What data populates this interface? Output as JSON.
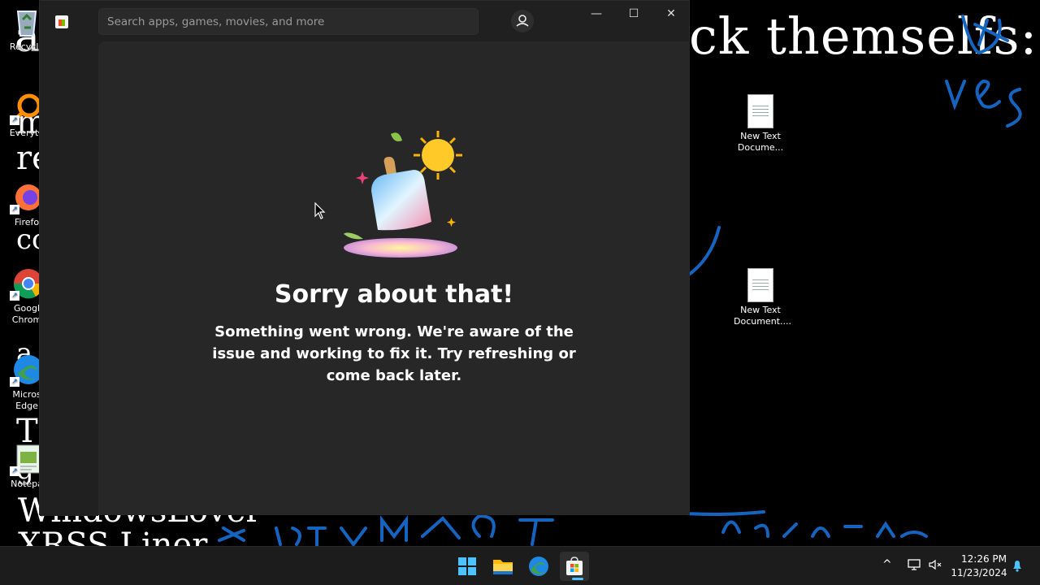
{
  "wallpaper": {
    "big_text": "ck themselfs:",
    "left_lines": [
      "a",
      "m",
      "re",
      "co",
      "a",
      "T",
      "g"
    ],
    "bottom_line_1": "WindowsLover",
    "bottom_line_2": "XRSS Liner"
  },
  "desktop_icons": {
    "recycle": "Recycle",
    "everything": "Everyth",
    "firefox": "Firefo",
    "chrome": "Googl Chrom",
    "edge": "Micros Edge",
    "notepad": "Notepa",
    "txt1": "New Text Docume...",
    "txt2": "New Text Document...."
  },
  "store": {
    "search_placeholder": "Search apps, games, movies, and more",
    "window_controls": {
      "minimize": "—",
      "maximize": "☐",
      "close": "✕"
    },
    "error_title": "Sorry about that!",
    "error_message": "Something went wrong. We're aware of the issue and working to fix it. Try refreshing or come back later."
  },
  "taskbar": {
    "apps": [
      "start",
      "file-explorer",
      "edge",
      "microsoft-store"
    ],
    "tray_chevron": "^",
    "time": "12:26 PM",
    "date": "11/23/2024"
  },
  "colors": {
    "accent": "#4cc2ff",
    "window_bg": "#202020",
    "content_bg": "#272727",
    "scribble_blue": "#1565c0"
  }
}
